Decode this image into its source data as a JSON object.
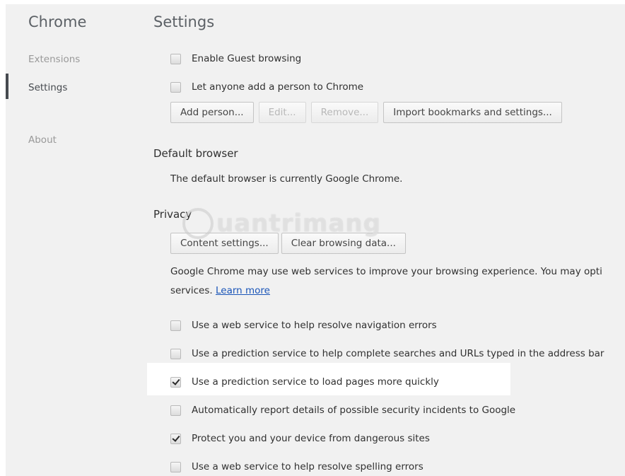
{
  "sidebar": {
    "app_title": "Chrome",
    "items": [
      {
        "label": "Extensions"
      },
      {
        "label": "Settings"
      },
      {
        "label": "About"
      }
    ]
  },
  "main": {
    "page_title": "Settings",
    "people": {
      "guest_browsing": {
        "label": "Enable Guest browsing",
        "checked": false
      },
      "add_person_anyone": {
        "label": "Let anyone add a person to Chrome",
        "checked": false
      },
      "buttons": {
        "add_person": "Add person...",
        "edit": "Edit...",
        "remove": "Remove...",
        "import": "Import bookmarks and settings..."
      }
    },
    "default_browser": {
      "title": "Default browser",
      "status": "The default browser is currently Google Chrome."
    },
    "privacy": {
      "title": "Privacy",
      "buttons": {
        "content_settings": "Content settings...",
        "clear_data": "Clear browsing data..."
      },
      "description": "Google Chrome may use web services to improve your browsing experience. You may opti",
      "description_line2": "services.",
      "learn_more": "Learn more",
      "options": [
        {
          "label": "Use a web service to help resolve navigation errors",
          "checked": false
        },
        {
          "label": "Use a prediction service to help complete searches and URLs typed in the address bar",
          "checked": false
        },
        {
          "label": "Use a prediction service to load pages more quickly",
          "checked": true
        },
        {
          "label": "Automatically report details of possible security incidents to Google",
          "checked": false
        },
        {
          "label": "Protect you and your device from dangerous sites",
          "checked": true
        },
        {
          "label": "Use a web service to help resolve spelling errors",
          "checked": false
        }
      ]
    }
  },
  "watermark": {
    "text": "uantrimang"
  }
}
